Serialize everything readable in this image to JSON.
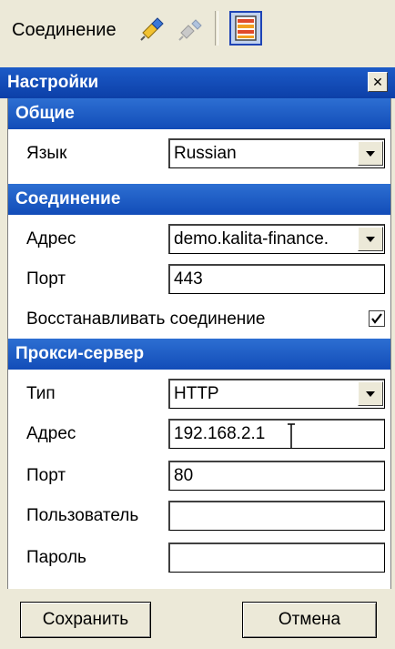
{
  "toolbar": {
    "connection_label": "Соединение",
    "icons": [
      "connect-icon",
      "disconnect-icon",
      "settings-panel-icon"
    ]
  },
  "panel": {
    "title": "Настройки",
    "close_symbol": "✕"
  },
  "sections": {
    "general": {
      "title": "Общие",
      "language_label": "Язык",
      "language_value": "Russian"
    },
    "connection": {
      "title": "Соединение",
      "address_label": "Адрес",
      "address_value": "demo.kalita-finance.",
      "port_label": "Порт",
      "port_value": "443",
      "restore_label": "Восстанавливать соединение",
      "restore_checked": true
    },
    "proxy": {
      "title": "Прокси-сервер",
      "type_label": "Тип",
      "type_value": "HTTP",
      "address_label": "Адрес",
      "address_value": "192.168.2.1",
      "port_label": "Порт",
      "port_value": "80",
      "user_label": "Пользователь",
      "user_value": "",
      "password_label": "Пароль",
      "password_value": ""
    }
  },
  "buttons": {
    "save": "Сохранить",
    "cancel": "Отмена"
  }
}
